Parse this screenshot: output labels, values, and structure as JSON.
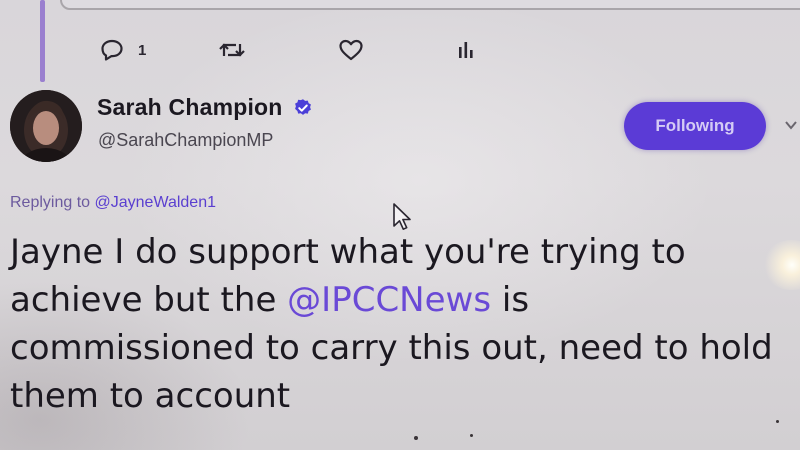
{
  "actions": {
    "reply_icon": "reply-icon",
    "reply_count": "1",
    "retweet_icon": "retweet-icon",
    "like_icon": "heart-icon",
    "stats_icon": "analytics-icon"
  },
  "author": {
    "name": "Sarah Champion",
    "verified": true,
    "handle": "@SarahChampionMP"
  },
  "follow_button": {
    "label": "Following",
    "color": "#5b3bd6"
  },
  "replying": {
    "prefix": "Replying to ",
    "mention": "@JayneWalden1"
  },
  "tweet": {
    "line1": "Jayne I do support what you're trying to",
    "line2_before": "achieve but the ",
    "line2_mention": "@IPCCNews",
    "line2_after": " is",
    "line3": "commissioned to carry this out, need to hold",
    "line4": "them to account"
  },
  "colors": {
    "accent": "#5b3bd6",
    "mention": "#6a49d6",
    "thread_line": "#9a7fcf"
  }
}
